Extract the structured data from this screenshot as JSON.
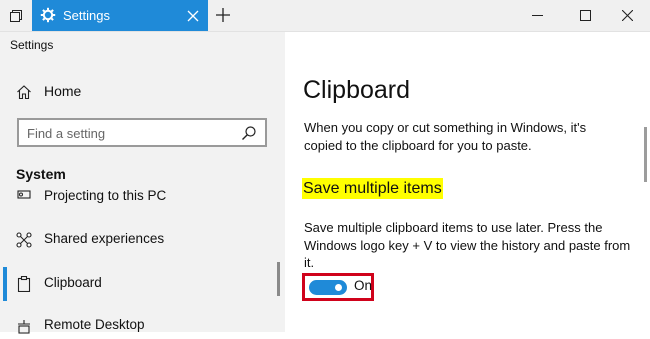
{
  "titlebar": {
    "tab_title": "Settings",
    "colors": {
      "tab": "#1f8ad8",
      "titlebar": "#f0f0f0"
    },
    "icons": [
      "task-view-icon",
      "gear-icon",
      "close-tab-icon",
      "new-tab-icon",
      "minimize-icon",
      "maximize-icon",
      "close-window-icon"
    ]
  },
  "nav": {
    "app_title": "Settings",
    "home_label": "Home",
    "search_placeholder": "Find a setting",
    "section_title": "System",
    "items": [
      {
        "label": "Projecting to this PC",
        "icon": "projector-icon"
      },
      {
        "label": "Shared experiences",
        "icon": "shared-icon"
      },
      {
        "label": "Clipboard",
        "icon": "clipboard-icon",
        "active": true
      },
      {
        "label": "Remote Desktop",
        "icon": "remote-desktop-icon"
      }
    ]
  },
  "main": {
    "title": "Clipboard",
    "intro": "When you copy or cut something in Windows, it's copied to the clipboard for you to paste.",
    "section_heading": "Save multiple items",
    "description": "Save multiple clipboard items to use later. Press the Windows logo key + V to view the history and paste from it.",
    "toggle_state": "On",
    "highlight_color": "#ffff00",
    "annotation_color": "#d0021b"
  }
}
